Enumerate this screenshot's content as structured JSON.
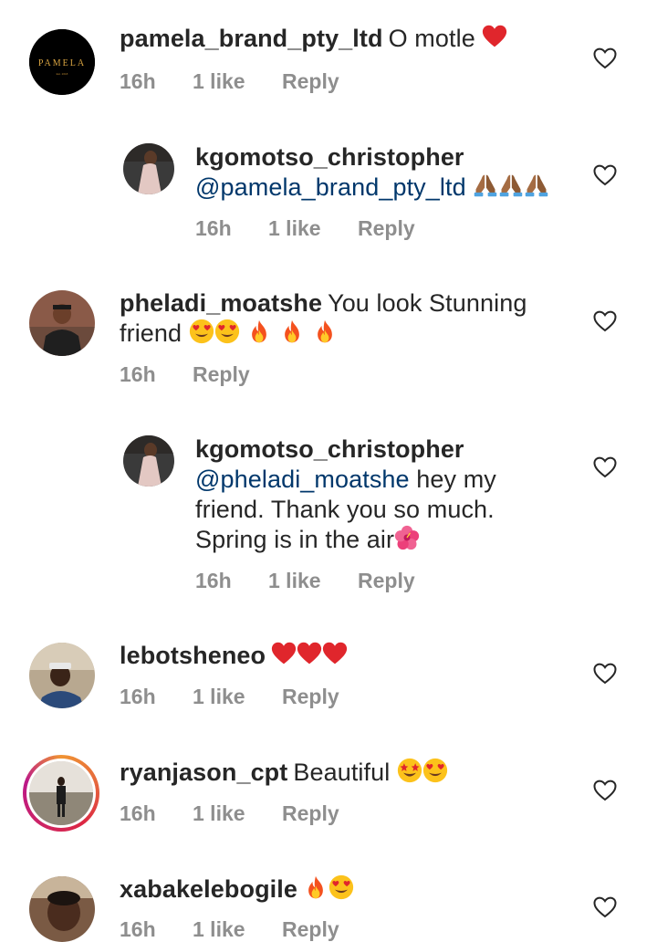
{
  "comments": [
    {
      "username": "pamela_brand_pty_ltd",
      "text": "O motle",
      "time": "16h",
      "likes": "1 like",
      "reply": "Reply",
      "avatar_label": "PAMELA",
      "avatar_sub": "Est. 2018",
      "emojis": [
        "red-heart"
      ]
    },
    {
      "username": "kgomotso_christopher",
      "mention": "@pamela_brand_pty_ltd",
      "text": "",
      "time": "16h",
      "likes": "1 like",
      "reply": "Reply",
      "emojis": [
        "folded-hands",
        "folded-hands",
        "folded-hands"
      ]
    },
    {
      "username": "pheladi_moatshe",
      "text_line1": "You look Stunning",
      "text_line2": "friend",
      "time": "16h",
      "reply": "Reply",
      "emojis": [
        "heart-eyes",
        "heart-eyes",
        "fire",
        "fire",
        "fire"
      ]
    },
    {
      "username": "kgomotso_christopher",
      "mention": "@pheladi_moatshe",
      "text_line1": "hey my",
      "text_line2": "friend. Thank you so much.",
      "text_line3": "Spring is in the air",
      "time": "16h",
      "likes": "1 like",
      "reply": "Reply",
      "emojis": [
        "hibiscus"
      ]
    },
    {
      "username": "lebotsheneo",
      "text": "",
      "time": "16h",
      "likes": "1 like",
      "reply": "Reply",
      "emojis": [
        "red-heart",
        "red-heart",
        "red-heart"
      ]
    },
    {
      "username": "ryanjason_cpt",
      "text": "Beautiful",
      "time": "16h",
      "likes": "1 like",
      "reply": "Reply",
      "emojis": [
        "star-struck",
        "heart-eyes"
      ]
    },
    {
      "username": "xabakelebogile",
      "text": "",
      "time": "16h",
      "likes": "1 like",
      "reply": "Reply",
      "emojis": [
        "fire",
        "heart-eyes"
      ]
    }
  ],
  "colors": {
    "text": "#262626",
    "meta": "#8e8e8e",
    "mention": "#00376b",
    "heart": "#e0262c"
  }
}
